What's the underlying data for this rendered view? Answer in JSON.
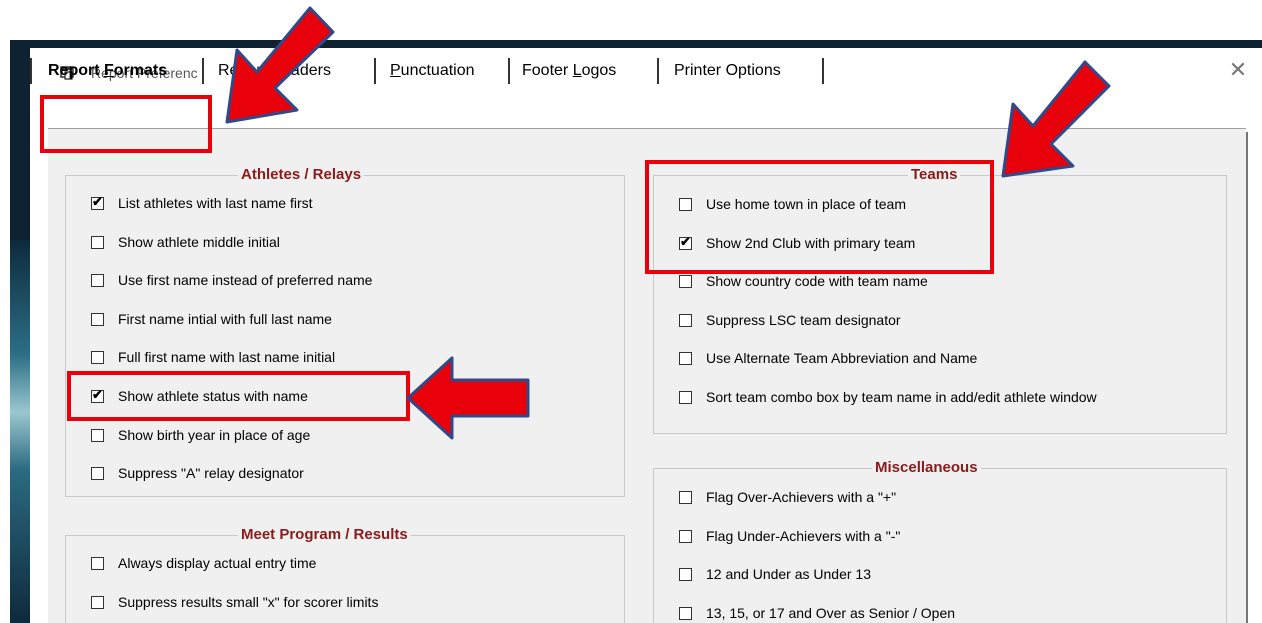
{
  "window": {
    "title": "Report Preferenc",
    "close_glyph": "✕"
  },
  "tabs": [
    {
      "label": "Report Formats",
      "prefix": "Report ",
      "accel": "F",
      "suffix": "ormats",
      "active": true
    },
    {
      "label": "Report Headers",
      "prefix": "Report ",
      "accel": "H",
      "suffix": "eaders",
      "active": false
    },
    {
      "label": "Punctuation",
      "prefix": "",
      "accel": "P",
      "suffix": "unctuation",
      "active": false
    },
    {
      "label": "Footer Logos",
      "prefix": "Footer ",
      "accel": "L",
      "suffix": "ogos",
      "active": false
    },
    {
      "label": "Printer Options",
      "prefix": "Printer Options",
      "accel": "",
      "suffix": "",
      "active": false
    }
  ],
  "groups": {
    "athletes": {
      "title": "Athletes / Relays",
      "options": [
        {
          "label": "List athletes with last name first",
          "checked": true
        },
        {
          "label": "Show athlete middle initial",
          "checked": false
        },
        {
          "label": "Use first name instead of preferred name",
          "checked": false
        },
        {
          "label": "First name intial with full last name",
          "checked": false
        },
        {
          "label": "Full first name with last name initial",
          "checked": false
        },
        {
          "label": "Show athlete status with name",
          "checked": true
        },
        {
          "label": "Show birth year in place of age",
          "checked": false
        },
        {
          "label": "Suppress \"A\" relay designator",
          "checked": false
        }
      ]
    },
    "meet": {
      "title": "Meet Program / Results",
      "options": [
        {
          "label": "Always display actual entry time",
          "checked": false
        },
        {
          "label": "Suppress results small \"x\" for scorer limits",
          "checked": false
        }
      ]
    },
    "teams": {
      "title": "Teams",
      "options": [
        {
          "label": "Use home town in place of team",
          "checked": false
        },
        {
          "label": "Show 2nd Club with primary team",
          "checked": true
        },
        {
          "label": "Show country code with team name",
          "checked": false
        },
        {
          "label": "Suppress LSC team designator",
          "checked": false
        },
        {
          "label": "Use Alternate Team Abbreviation and Name",
          "checked": false
        },
        {
          "label": "Sort team combo box by team name in add/edit athlete window",
          "checked": false
        }
      ]
    },
    "misc": {
      "title": "Miscellaneous",
      "options": [
        {
          "label": "Flag Over-Achievers with a \"+\"",
          "checked": false
        },
        {
          "label": "Flag Under-Achievers with a \"-\"",
          "checked": false
        },
        {
          "label": "12 and Under as Under 13",
          "checked": false
        },
        {
          "label": "13, 15, or 17 and Over as Senior / Open",
          "checked": false
        }
      ]
    }
  },
  "check_glyph": "✔",
  "colors": {
    "highlight": "#e8000b",
    "arrow_fill": "#e8000b",
    "arrow_outline": "#2f4a8a",
    "group_title": "#8b1a1a"
  }
}
